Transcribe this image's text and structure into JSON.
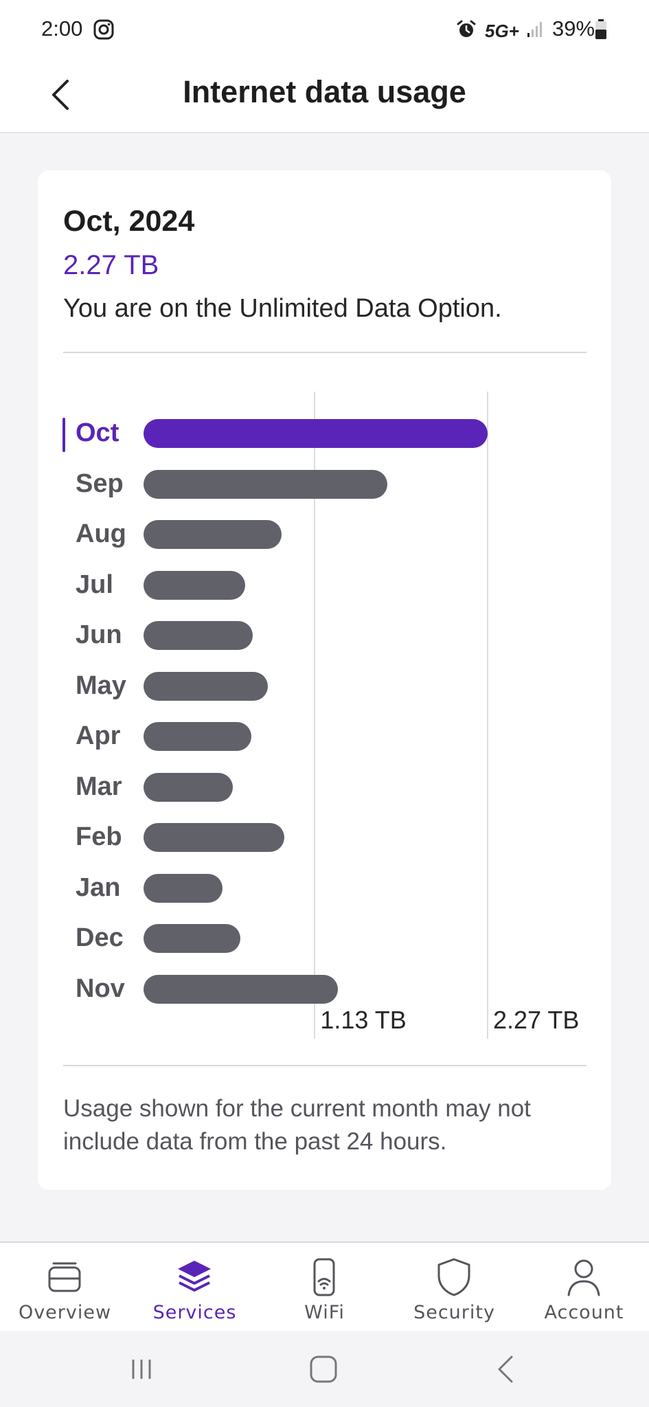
{
  "status_bar": {
    "time": "2:00",
    "network": "5G+",
    "battery": "39%"
  },
  "header": {
    "title": "Internet data usage"
  },
  "summary": {
    "month": "Oct, 2024",
    "total": "2.27 TB",
    "plan_text": "You are on the Unlimited Data Option."
  },
  "chart_data": {
    "type": "bar",
    "orientation": "horizontal",
    "categories": [
      "Oct",
      "Sep",
      "Aug",
      "Jul",
      "Jun",
      "May",
      "Apr",
      "Mar",
      "Feb",
      "Jan",
      "Dec",
      "Nov"
    ],
    "values": [
      2.27,
      1.61,
      0.91,
      0.67,
      0.72,
      0.82,
      0.71,
      0.59,
      0.93,
      0.52,
      0.64,
      1.28
    ],
    "unit": "TB",
    "xlim": [
      0,
      2.27
    ],
    "tick_values": [
      1.13,
      2.27
    ],
    "tick_labels": [
      "1.13 TB",
      "2.27 TB"
    ],
    "highlight": "Oct",
    "colors": {
      "current": "#5a24b8",
      "past": "#61616a"
    },
    "grid": true
  },
  "footnote": "Usage shown for the current month may not include data from the past 24 hours.",
  "bottom_nav": [
    {
      "label": "Overview",
      "icon": "overview-icon",
      "active": false
    },
    {
      "label": "Services",
      "icon": "layers-icon",
      "active": true
    },
    {
      "label": "WiFi",
      "icon": "wifi-device-icon",
      "active": false
    },
    {
      "label": "Security",
      "icon": "shield-icon",
      "active": false
    },
    {
      "label": "Account",
      "icon": "person-icon",
      "active": false
    }
  ],
  "colors": {
    "accent": "#5a24b8",
    "bar_past": "#61616a",
    "background": "#f4f4f6"
  }
}
